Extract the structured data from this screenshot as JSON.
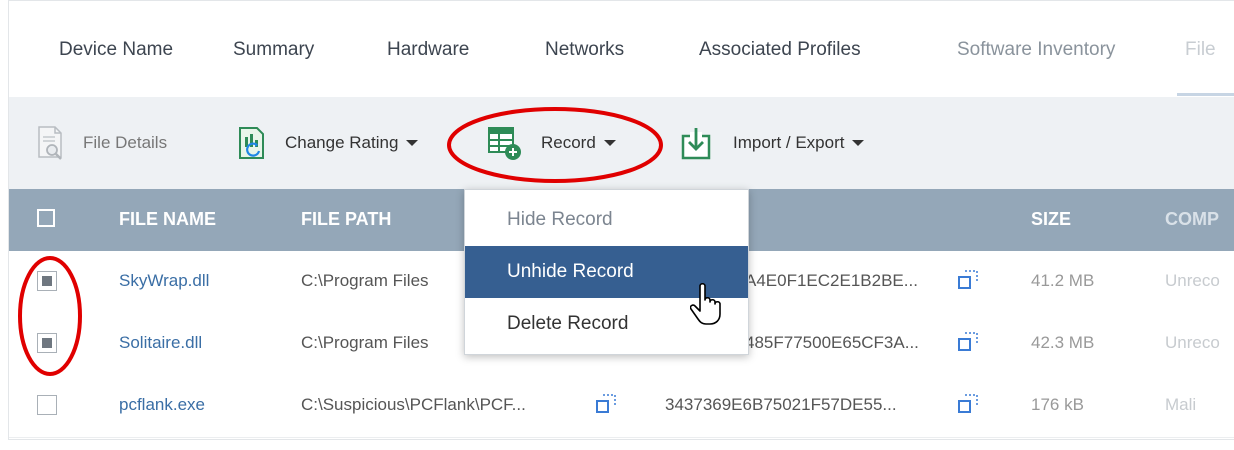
{
  "tabs": [
    {
      "label": "Device Name"
    },
    {
      "label": "Summary"
    },
    {
      "label": "Hardware"
    },
    {
      "label": "Networks"
    },
    {
      "label": "Associated Profiles"
    },
    {
      "label": "Software Inventory"
    },
    {
      "label": "File"
    }
  ],
  "toolbar": {
    "file_details": "File Details",
    "change_rating": "Change Rating",
    "record": "Record",
    "import_export": "Import / Export"
  },
  "table": {
    "headers": {
      "file_name": "FILE NAME",
      "file_path": "FILE PATH",
      "size": "SIZE",
      "comp": "COMP"
    },
    "rows": [
      {
        "name": "SkyWrap.dll",
        "path": "C:\\Program Files",
        "hash": "A4E0F1EC2E1B2BE...",
        "size": "41.2 MB",
        "rating": "Unreco",
        "checked": true
      },
      {
        "name": "Solitaire.dll",
        "path": "C:\\Program Files",
        "hash": "485F77500E65CF3A...",
        "size": "42.3 MB",
        "rating": "Unreco",
        "checked": true
      },
      {
        "name": "pcflank.exe",
        "path": "C:\\Suspicious\\PCFlank\\PCF...",
        "hash": "3437369E6B75021F57DE55...",
        "size": "176 kB",
        "rating": "Mali",
        "checked": false
      }
    ]
  },
  "dropdown": {
    "items": [
      {
        "label": "Hide Record",
        "state": "disabled"
      },
      {
        "label": "Unhide Record",
        "state": "highlighted"
      },
      {
        "label": "Delete Record",
        "state": "normal"
      }
    ]
  },
  "colors": {
    "header_bg": "#94a7b8",
    "toolbar_bg": "#eef1f4",
    "menu_highlight": "#365f91",
    "link": "#3a6ea5",
    "annotation": "#e00000"
  },
  "icons": {
    "file_details": "file-search-icon",
    "change_rating": "rating-change-icon",
    "record": "record-table-icon",
    "import_export": "import-export-icon",
    "copy": "copy-icon",
    "cursor": "hand-pointer-icon"
  }
}
